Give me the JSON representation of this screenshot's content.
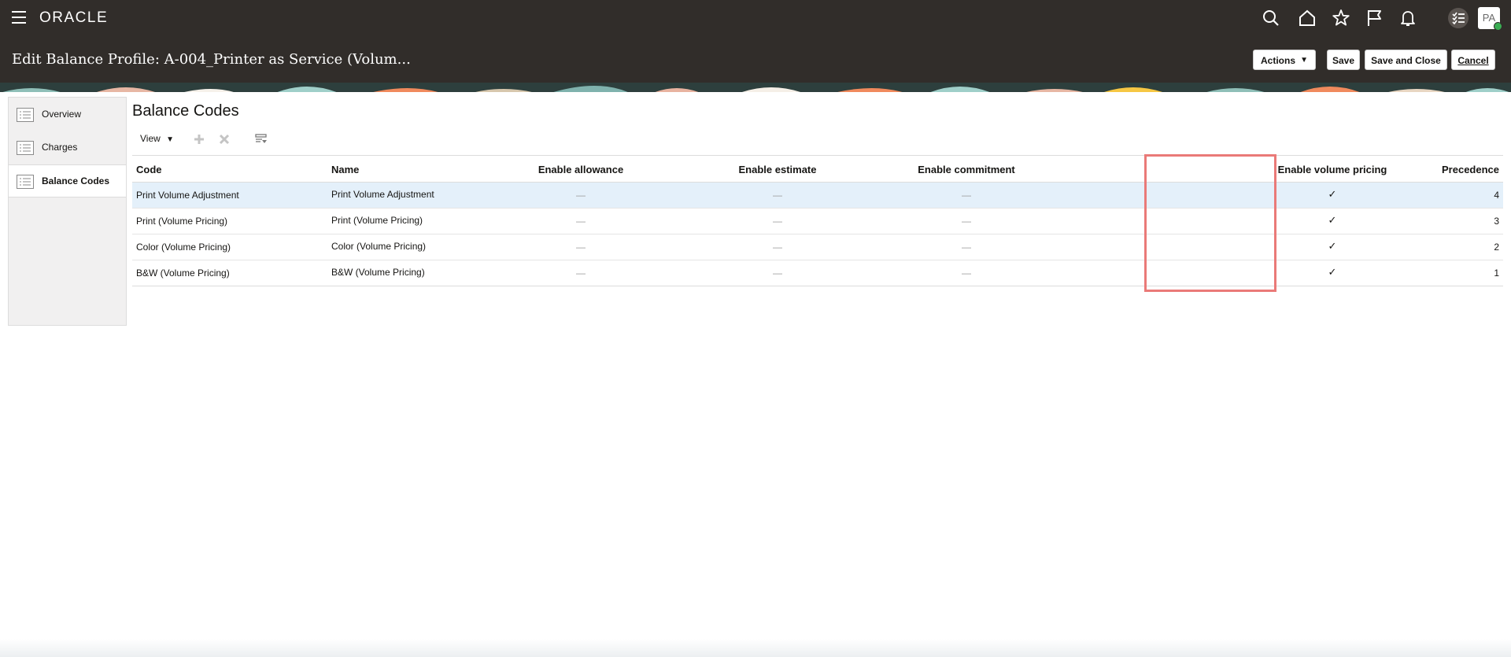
{
  "app": {
    "brand": "ORACLE",
    "avatar_initials": "PA"
  },
  "header": {
    "title": "Edit Balance Profile: A-004_Printer as Service (Volum...",
    "actions_label": "Actions",
    "save_label": "Save",
    "save_close_label": "Save and Close",
    "cancel_label": "Cancel"
  },
  "sidebar": {
    "items": [
      {
        "label": "Overview",
        "icon": "list-icon"
      },
      {
        "label": "Charges",
        "icon": "list-icon"
      },
      {
        "label": "Balance Codes",
        "icon": "list-icon"
      }
    ],
    "active": "Balance Codes"
  },
  "section": {
    "title": "Balance Codes",
    "view_label": "View"
  },
  "table": {
    "columns": [
      "Code",
      "Name",
      "Enable allowance",
      "Enable estimate",
      "Enable commitment",
      "Enable volume pricing",
      "Precedence"
    ],
    "rows": [
      {
        "code": "Print Volume Adjustment",
        "name": "Print Volume Adjustment",
        "allowance": "—",
        "estimate": "—",
        "commitment": "—",
        "volume_pricing": "✓",
        "precedence": "4"
      },
      {
        "code": "Print (Volume Pricing)",
        "name": "Print (Volume Pricing)",
        "allowance": "—",
        "estimate": "—",
        "commitment": "—",
        "volume_pricing": "✓",
        "precedence": "3"
      },
      {
        "code": "Color (Volume Pricing)",
        "name": "Color (Volume Pricing)",
        "allowance": "—",
        "estimate": "—",
        "commitment": "—",
        "volume_pricing": "✓",
        "precedence": "2"
      },
      {
        "code": "B&W (Volume Pricing)",
        "name": "B&W (Volume Pricing)",
        "allowance": "—",
        "estimate": "—",
        "commitment": "—",
        "volume_pricing": "✓",
        "precedence": "1"
      }
    ]
  },
  "colors": {
    "header_bg": "#312d2a",
    "highlight_border": "#ea7a78",
    "selected_row": "#e4f0fa",
    "presence": "#3bad53"
  }
}
